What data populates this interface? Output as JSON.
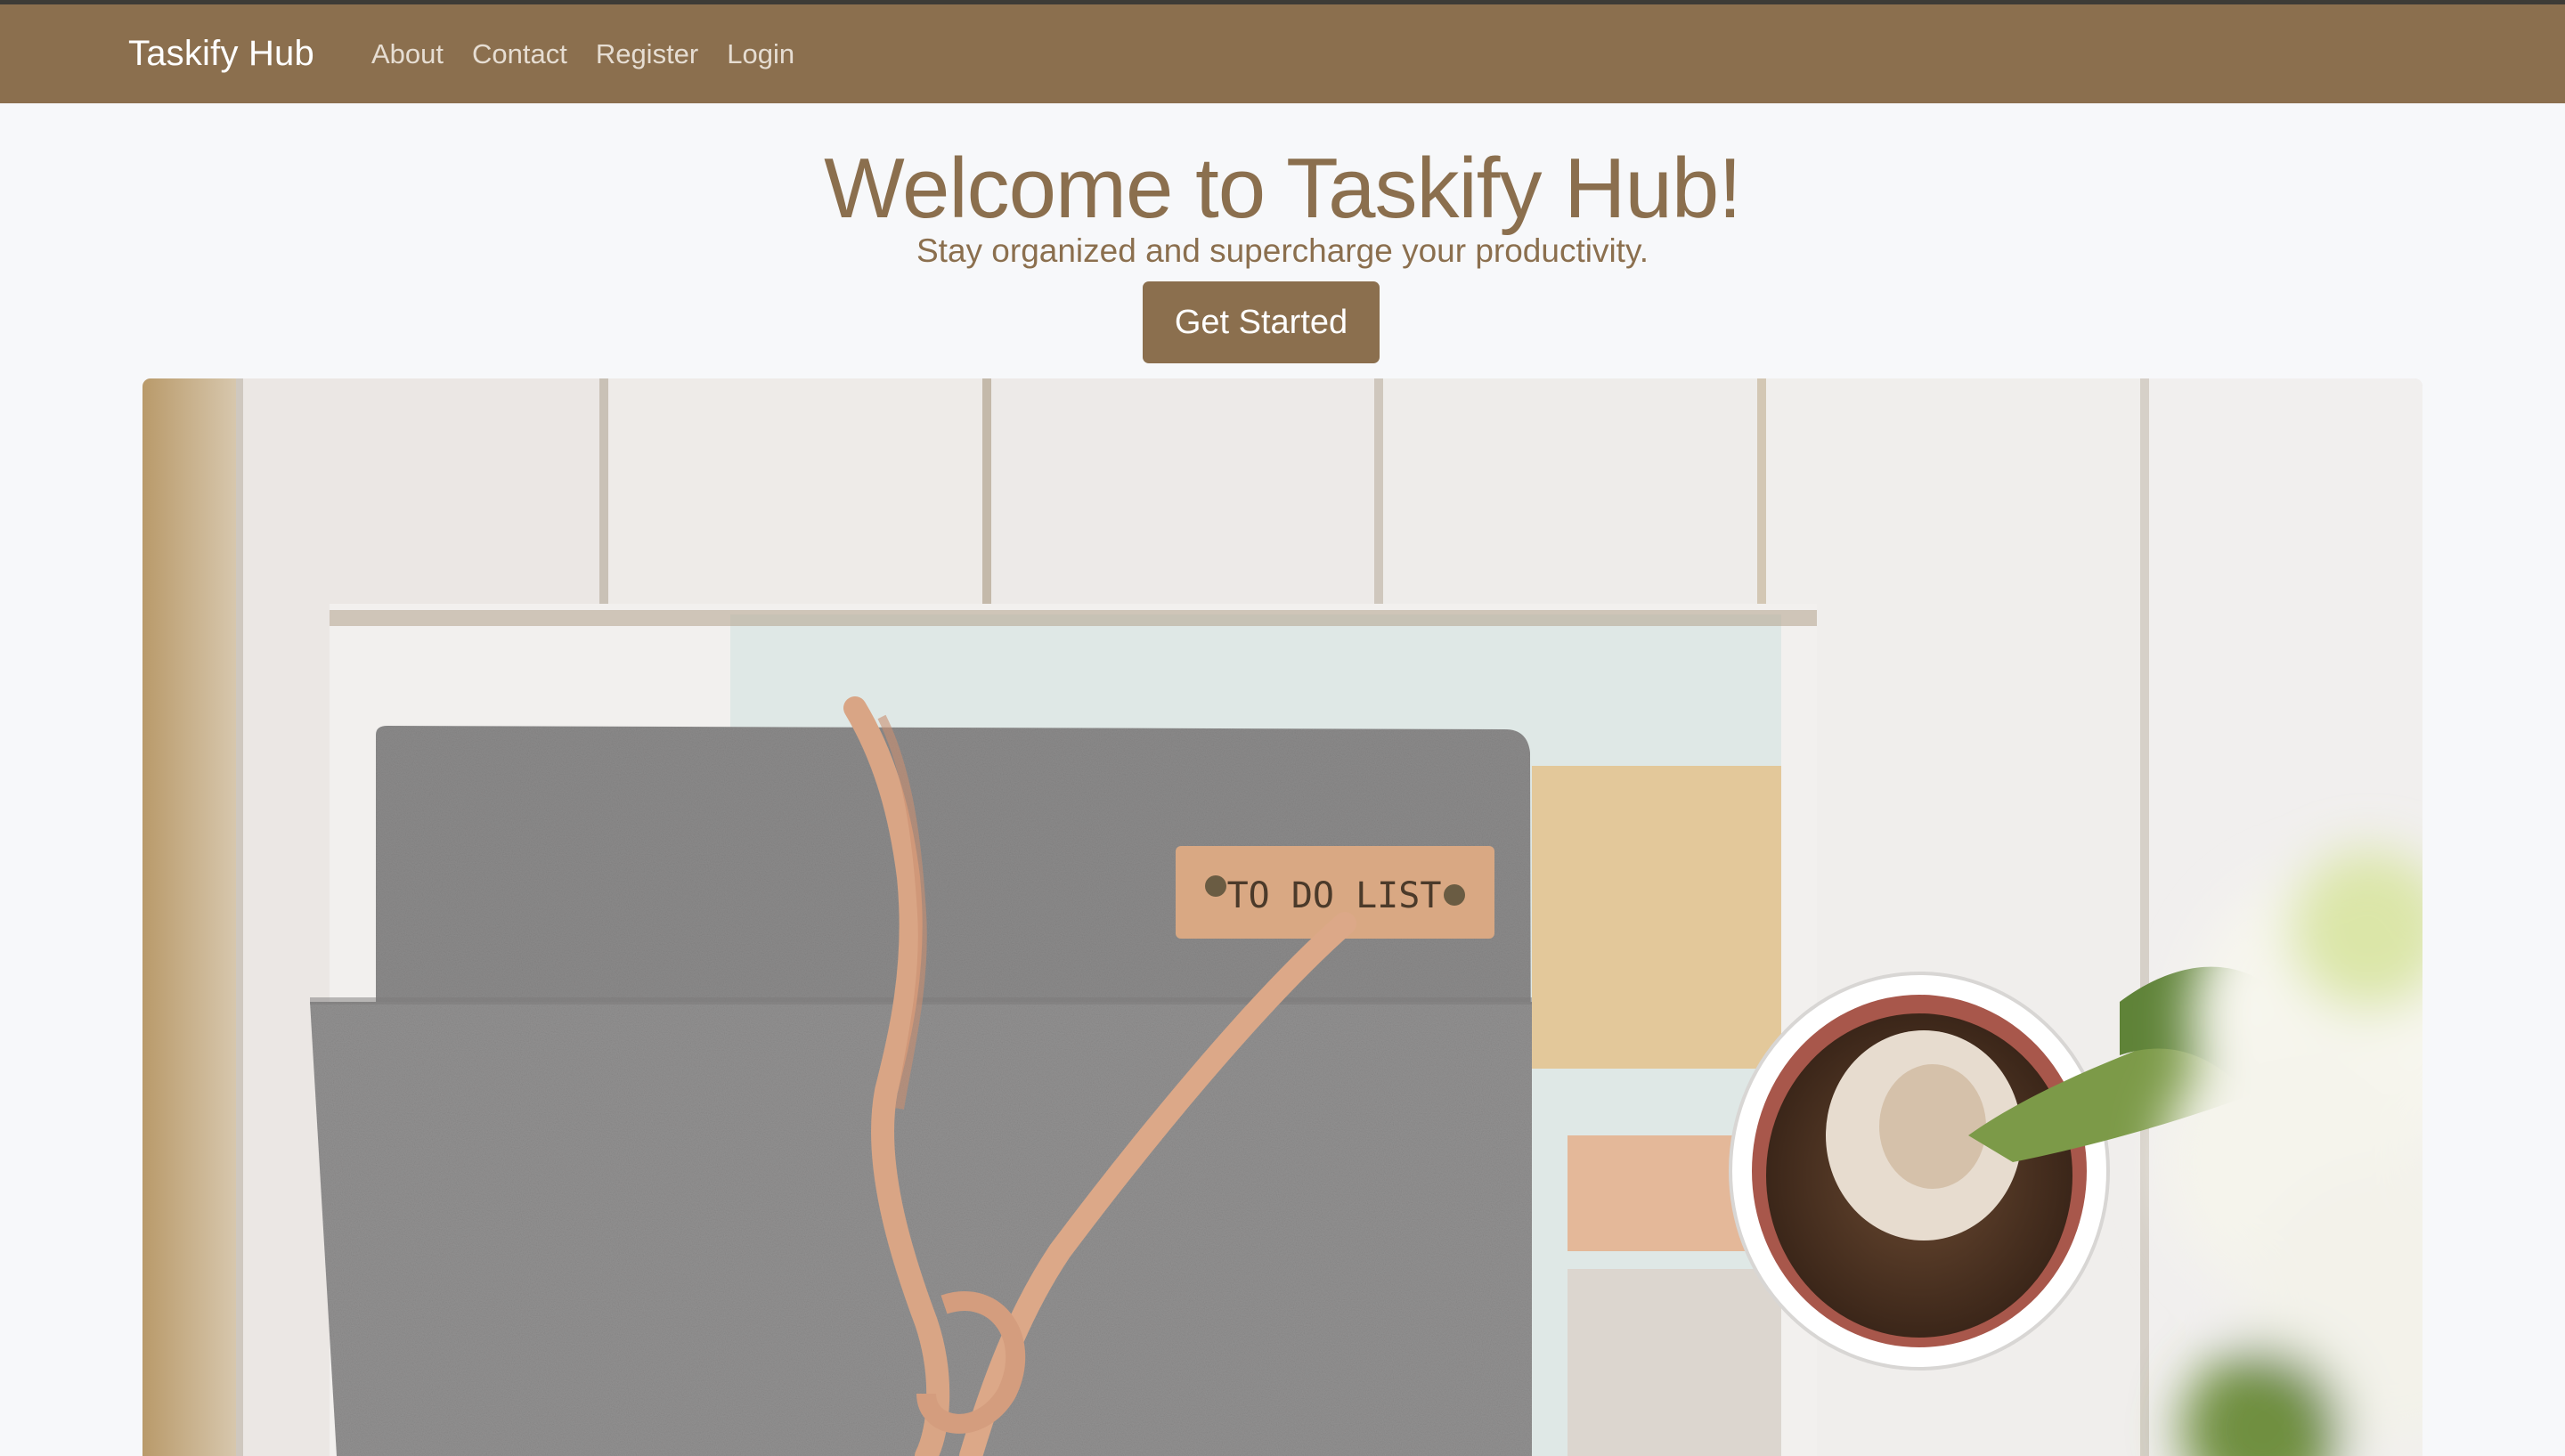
{
  "navbar": {
    "brand": "Taskify Hub",
    "links": [
      "About",
      "Contact",
      "Register",
      "Login"
    ]
  },
  "hero": {
    "title": "Welcome to Taskify Hub!",
    "subtitle": "Stay organized and supercharge your productivity.",
    "cta_label": "Get Started"
  },
  "photo": {
    "tag_text": "TO DO LIST"
  },
  "colors": {
    "brand": "#8b6f4e",
    "background": "#f7f8fa",
    "nav_link": "#e6ddd2"
  }
}
